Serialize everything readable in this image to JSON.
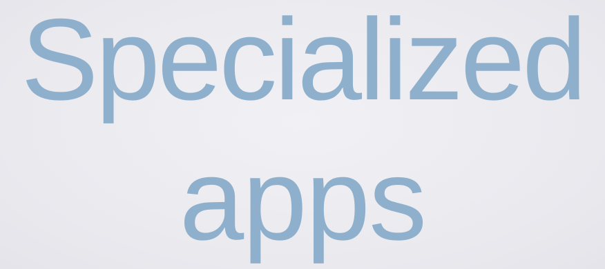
{
  "slide": {
    "title_line_1": "Specialized",
    "title_line_2": "apps"
  },
  "colors": {
    "text": "#8fb0cc",
    "background": "#ececf0"
  }
}
